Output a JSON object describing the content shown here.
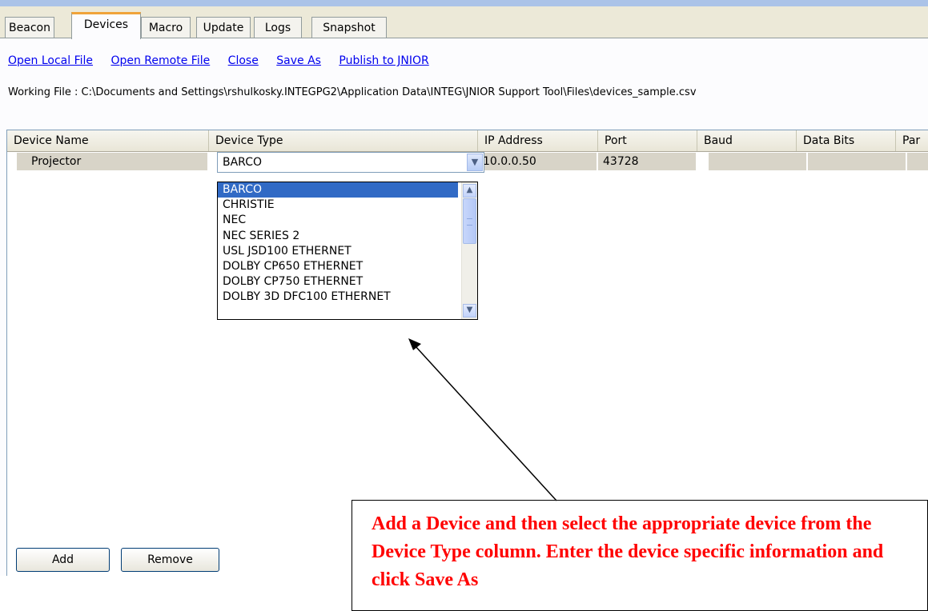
{
  "tabs": [
    "Beacon",
    "Devices",
    "Macro",
    "Update",
    "Logs",
    "Snapshot"
  ],
  "links": [
    "Open Local File",
    "Open Remote File",
    "Close",
    "Save As",
    "Publish to JNIOR"
  ],
  "working_file": "Working File : C:\\Documents and Settings\\rshulkosky.INTEGPG2\\Application Data\\INTEG\\JNIOR Support Tool\\Files\\devices_sample.csv",
  "grid": {
    "headers": [
      "Device Name",
      "Device Type",
      "IP Address",
      "Port",
      "Baud",
      "Data Bits",
      "Par"
    ],
    "row": {
      "device_name": "Projector",
      "device_type": "BARCO",
      "ip": "10.0.0.50",
      "port": "43728",
      "baud": "",
      "data_bits": "",
      "parity": ""
    }
  },
  "dropdown_options": [
    "BARCO",
    "CHRISTIE",
    "NEC",
    "NEC SERIES 2",
    "USL JSD100 ETHERNET",
    "DOLBY CP650 ETHERNET",
    "DOLBY CP750 ETHERNET",
    "DOLBY 3D DFC100 ETHERNET"
  ],
  "buttons": {
    "add": "Add",
    "remove": "Remove"
  },
  "callout_text": "Add a Device and then select the appropriate device from the Device Type column.  Enter the device specific information and click Save As",
  "icons": {
    "combo_arrow": "chevron-down-icon",
    "scroll_up": "chevron-up-icon",
    "scroll_down": "chevron-down-icon"
  },
  "colors": {
    "selection": "#316ac5",
    "link": "#0000ee",
    "callout_text": "#ff0000",
    "tab_highlight": "#f0a33a"
  }
}
